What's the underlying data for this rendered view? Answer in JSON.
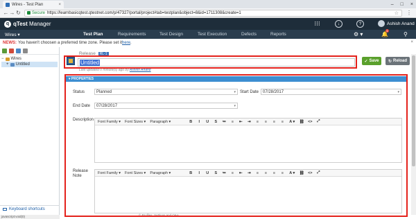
{
  "browser": {
    "tab_title": "Wires - Test Plan",
    "tab_close": "×",
    "secure_label": "Secure",
    "url": "https://learnbasicqtest.qtestnet.com/p/47327/portal/project#tab=testplan&object=8&id=1711308&create=1",
    "window_controls": [
      "–",
      "□",
      "×"
    ]
  },
  "app": {
    "logo_mark": "q",
    "logo_brand": "qTest",
    "logo_product": " Manager",
    "user_name": "Ashish Anand",
    "notification_count": "1"
  },
  "nav": {
    "project": "Wires ▾",
    "items": [
      "Test Plan",
      "Requirements",
      "Test Design",
      "Test Execution",
      "Defects",
      "Reports"
    ],
    "active": "Test Plan"
  },
  "news": {
    "label": "NEWS:",
    "text": "You haven't choosen a preferred time zone. Please set it ",
    "link": "here",
    "close": "×"
  },
  "tree": {
    "root": "Wires",
    "child": "Untitled"
  },
  "left_footer": {
    "shortcuts": "Keyboard shortcuts"
  },
  "release": {
    "label": "Release",
    "tag": "RL-1",
    "title": "Untitled",
    "updated_prefix": "Last updated 0 minute(s) ago by ",
    "updated_by": "Ashish Anand",
    "save": "Save",
    "reload": "Reload"
  },
  "properties": {
    "header": "▾ PROPERTIES",
    "status_label": "Status",
    "status_value": "Planned",
    "start_label": "Start Date",
    "start_value": "07/28/2017",
    "end_label": "End Date",
    "end_value": "07/28/2017",
    "description_label": "Description",
    "release_note_label_1": "Release",
    "release_note_label_2": "Note"
  },
  "editor_toolbar": {
    "font_family": "Font Family ▾",
    "font_sizes": "Font Sizes ▾",
    "paragraph": "Paragraph ▾",
    "buttons": [
      "B",
      "I",
      "U",
      "S",
      "≔",
      "≡",
      "⇤",
      "⇥",
      "≡",
      "≡",
      "≡",
      "≡",
      "A ▾",
      "⛓",
      "<>",
      "⤢"
    ]
  },
  "footer": {
    "text": "© Profiles, Settings and Q&A...",
    "status": "javascript:void(0)"
  },
  "colors": {
    "header_bg": "#1e2d3a",
    "nav_bg": "#2a3d4e",
    "accent": "#3d8ed1",
    "save": "#5aa02c",
    "highlight": "#e4211b"
  }
}
